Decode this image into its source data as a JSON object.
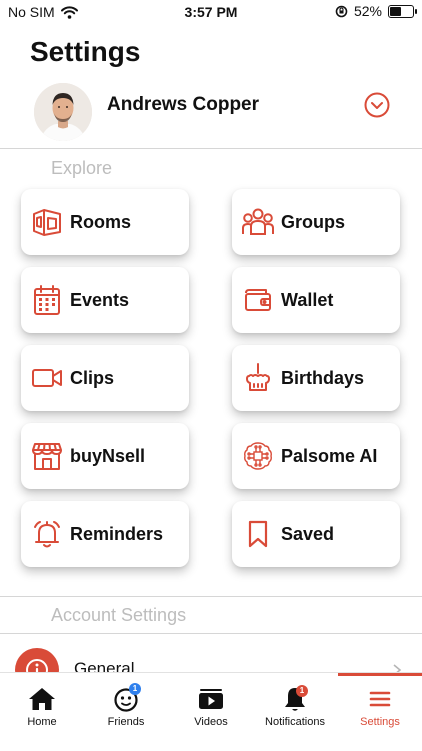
{
  "status_bar": {
    "carrier": "No SIM",
    "time": "3:57 PM",
    "battery": "52%",
    "battery_level": 0.52
  },
  "page": {
    "title": "Settings"
  },
  "profile": {
    "name": "Andrews Copper"
  },
  "explore": {
    "label": "Explore",
    "items": [
      {
        "label": "Rooms",
        "icon": "rooms-icon"
      },
      {
        "label": "Groups",
        "icon": "groups-icon"
      },
      {
        "label": "Events",
        "icon": "calendar-icon"
      },
      {
        "label": "Wallet",
        "icon": "wallet-icon"
      },
      {
        "label": "Clips",
        "icon": "video-camera-icon"
      },
      {
        "label": "Birthdays",
        "icon": "cake-icon"
      },
      {
        "label": "buyNsell",
        "icon": "storefront-icon"
      },
      {
        "label": "Palsome AI",
        "icon": "brain-icon"
      },
      {
        "label": "Reminders",
        "icon": "bell-icon"
      },
      {
        "label": "Saved",
        "icon": "bookmark-icon"
      }
    ]
  },
  "account_settings": {
    "label": "Account Settings",
    "items": [
      {
        "label": "General",
        "icon": "info-icon"
      }
    ]
  },
  "tabbar": {
    "tabs": [
      {
        "label": "Home",
        "icon": "home-icon"
      },
      {
        "label": "Friends",
        "icon": "friends-icon",
        "badge": "1"
      },
      {
        "label": "Videos",
        "icon": "video-icon"
      },
      {
        "label": "Notifications",
        "icon": "bell-icon",
        "badge": "1"
      },
      {
        "label": "Settings",
        "icon": "menu-icon",
        "active": true
      }
    ]
  },
  "colors": {
    "accent": "#d94b38",
    "friends_badge": "#2f80ed",
    "notifications_badge": "#d94b38"
  }
}
